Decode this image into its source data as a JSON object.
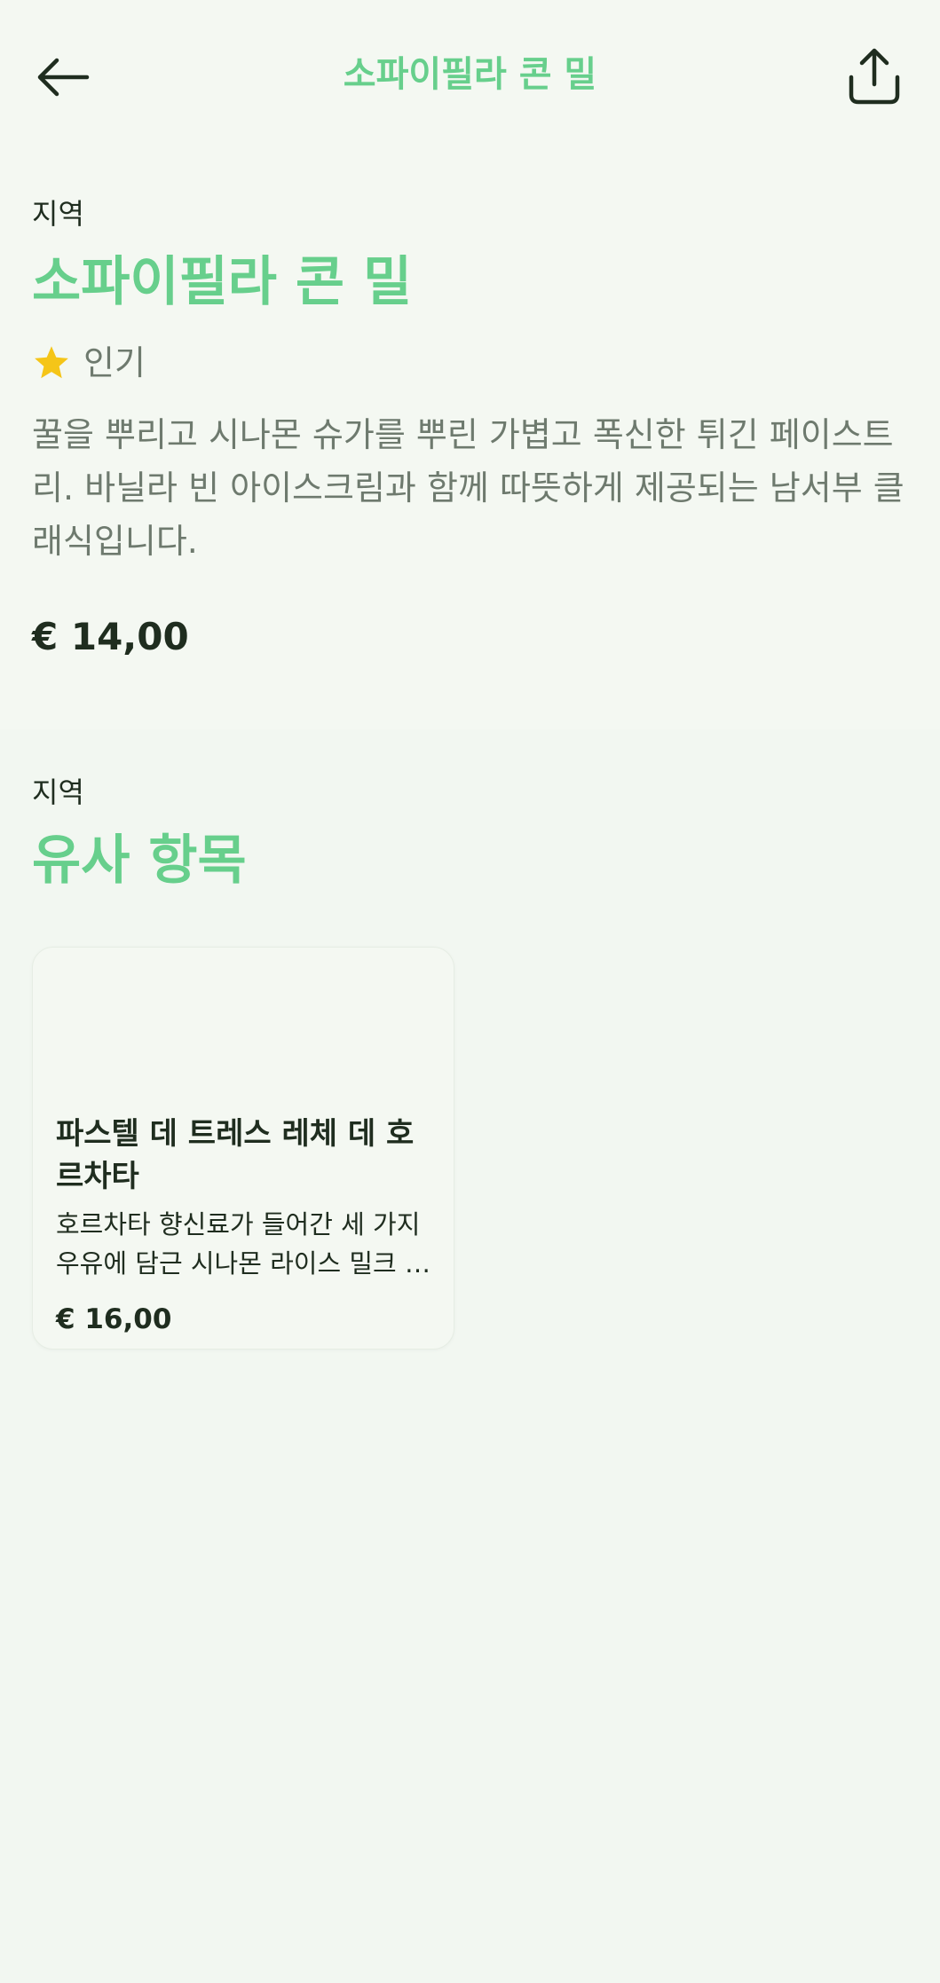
{
  "header": {
    "title": "소파이필라 콘 밀",
    "back_icon": "arrow-left-icon",
    "share_icon": "share-icon"
  },
  "item": {
    "category": "지역",
    "name": "소파이필라 콘 밀",
    "badge": "인기",
    "badge_icon": "star-icon",
    "description": "꿀을 뿌리고 시나몬 슈가를 뿌린 가볍고 폭신한 튀긴 페이스트리. 바닐라 빈 아이스크림과 함께 따뜻하게 제공되는 남서부 클래식입니다.",
    "price": "€ 14,00"
  },
  "similar": {
    "category": "지역",
    "heading": "유사 항목",
    "items": [
      {
        "name": "파스텔 데 트레스 레체 데 호르차타",
        "description": "호르차타 향신료가 들어간 세 가지 우유에 담근 시나몬 라이스 밀크 케이크",
        "price": "€ 16,00"
      }
    ]
  },
  "colors": {
    "accent": "#67cf8c",
    "star": "#f5c518",
    "text": "#1f2d1f",
    "muted": "#6e7a6e",
    "background": "#f4f8f2"
  }
}
